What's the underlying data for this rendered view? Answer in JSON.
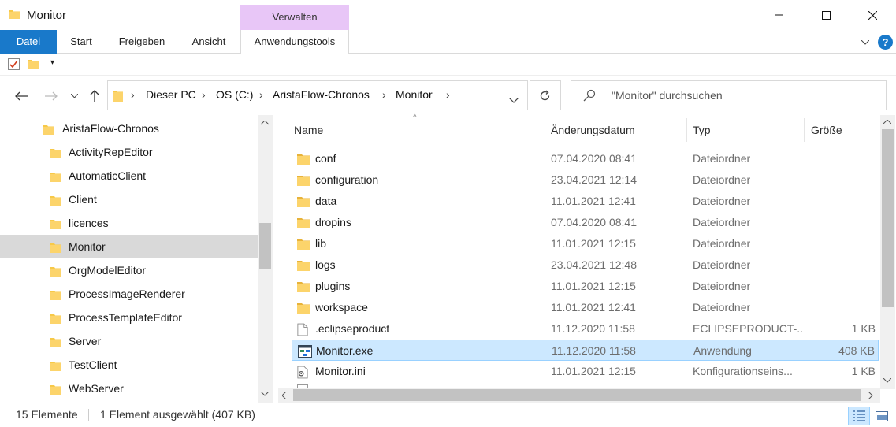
{
  "window": {
    "title": "Monitor",
    "contextual_group": "Verwalten"
  },
  "ribbon": {
    "tabs": [
      "Datei",
      "Start",
      "Freigeben",
      "Ansicht",
      "Anwendungstools"
    ]
  },
  "address": {
    "breadcrumbs": [
      "Dieser PC",
      "OS (C:)",
      "AristaFlow-Chronos",
      "Monitor"
    ]
  },
  "search": {
    "placeholder": "\"Monitor\" durchsuchen"
  },
  "nav": {
    "items": [
      {
        "label": "AristaFlow-Chronos",
        "indent": 1
      },
      {
        "label": "ActivityRepEditor",
        "indent": 2
      },
      {
        "label": "AutomaticClient",
        "indent": 2
      },
      {
        "label": "Client",
        "indent": 2
      },
      {
        "label": "licences",
        "indent": 2
      },
      {
        "label": "Monitor",
        "indent": 2,
        "selected": true
      },
      {
        "label": "OrgModelEditor",
        "indent": 2
      },
      {
        "label": "ProcessImageRenderer",
        "indent": 2
      },
      {
        "label": "ProcessTemplateEditor",
        "indent": 2
      },
      {
        "label": "Server",
        "indent": 2
      },
      {
        "label": "TestClient",
        "indent": 2
      },
      {
        "label": "WebServer",
        "indent": 2
      }
    ]
  },
  "list": {
    "columns": [
      "Name",
      "Änderungsdatum",
      "Typ",
      "Größe"
    ],
    "rows": [
      {
        "name": "conf",
        "date": "07.04.2020 08:41",
        "type": "Dateiordner",
        "size": "",
        "icon": "folder-icon"
      },
      {
        "name": "configuration",
        "date": "23.04.2021 12:14",
        "type": "Dateiordner",
        "size": "",
        "icon": "folder-icon"
      },
      {
        "name": "data",
        "date": "11.01.2021 12:41",
        "type": "Dateiordner",
        "size": "",
        "icon": "folder-icon"
      },
      {
        "name": "dropins",
        "date": "07.04.2020 08:41",
        "type": "Dateiordner",
        "size": "",
        "icon": "folder-icon"
      },
      {
        "name": "lib",
        "date": "11.01.2021 12:15",
        "type": "Dateiordner",
        "size": "",
        "icon": "folder-icon"
      },
      {
        "name": "logs",
        "date": "23.04.2021 12:48",
        "type": "Dateiordner",
        "size": "",
        "icon": "folder-icon"
      },
      {
        "name": "plugins",
        "date": "11.01.2021 12:15",
        "type": "Dateiordner",
        "size": "",
        "icon": "folder-icon"
      },
      {
        "name": "workspace",
        "date": "11.01.2021 12:41",
        "type": "Dateiordner",
        "size": "",
        "icon": "folder-icon"
      },
      {
        "name": ".eclipseproduct",
        "date": "11.12.2020 11:58",
        "type": "ECLIPSEPRODUCT-...",
        "size": "1 KB",
        "icon": "file-icon"
      },
      {
        "name": "Monitor.exe",
        "date": "11.12.2020 11:58",
        "type": "Anwendung",
        "size": "408 KB",
        "icon": "exe-icon",
        "selected": true
      },
      {
        "name": "Monitor.ini",
        "date": "11.01.2021 12:15",
        "type": "Konfigurationseins...",
        "size": "1 KB",
        "icon": "ini-icon"
      }
    ]
  },
  "status": {
    "count": "15 Elemente",
    "selection": "1 Element ausgewählt (407 KB)"
  },
  "colors": {
    "accent": "#1979ca",
    "selection": "#cce8ff",
    "contextual": "#e8c6f7",
    "folder": "#f7c948"
  }
}
